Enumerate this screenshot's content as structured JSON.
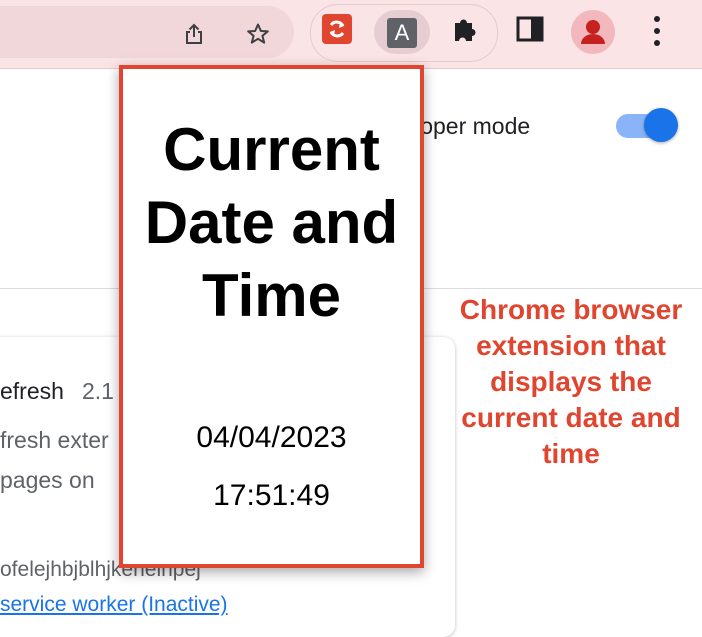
{
  "toolbar": {
    "icons": [
      "share-icon",
      "bookmark-star-icon",
      "auto-refresh-extension-icon",
      "date-time-extension-icon",
      "extensions-puzzle-icon",
      "side-panel-icon",
      "profile-avatar-icon",
      "menu-icon"
    ],
    "active_extension_letter": "A"
  },
  "page": {
    "developer_mode_label": "eveloper mode",
    "developer_mode_on": true,
    "extension_card": {
      "name": "efresh",
      "version": "2.1",
      "description_line1": "fresh exter",
      "description_line2": "pages on",
      "id_text": "ofelejhbjblhjkeheihpej",
      "service_worker_link": "service worker (Inactive)"
    }
  },
  "popup": {
    "title": "Current Date and Time",
    "date": "04/04/2023",
    "time": "17:51:49"
  },
  "annotation": {
    "text": "Chrome browser extension that displays the current date and time"
  },
  "colors": {
    "toolbar_bg": "#fbe4e6",
    "accent_red": "#e0452f",
    "toggle_blue": "#1a73e8"
  }
}
